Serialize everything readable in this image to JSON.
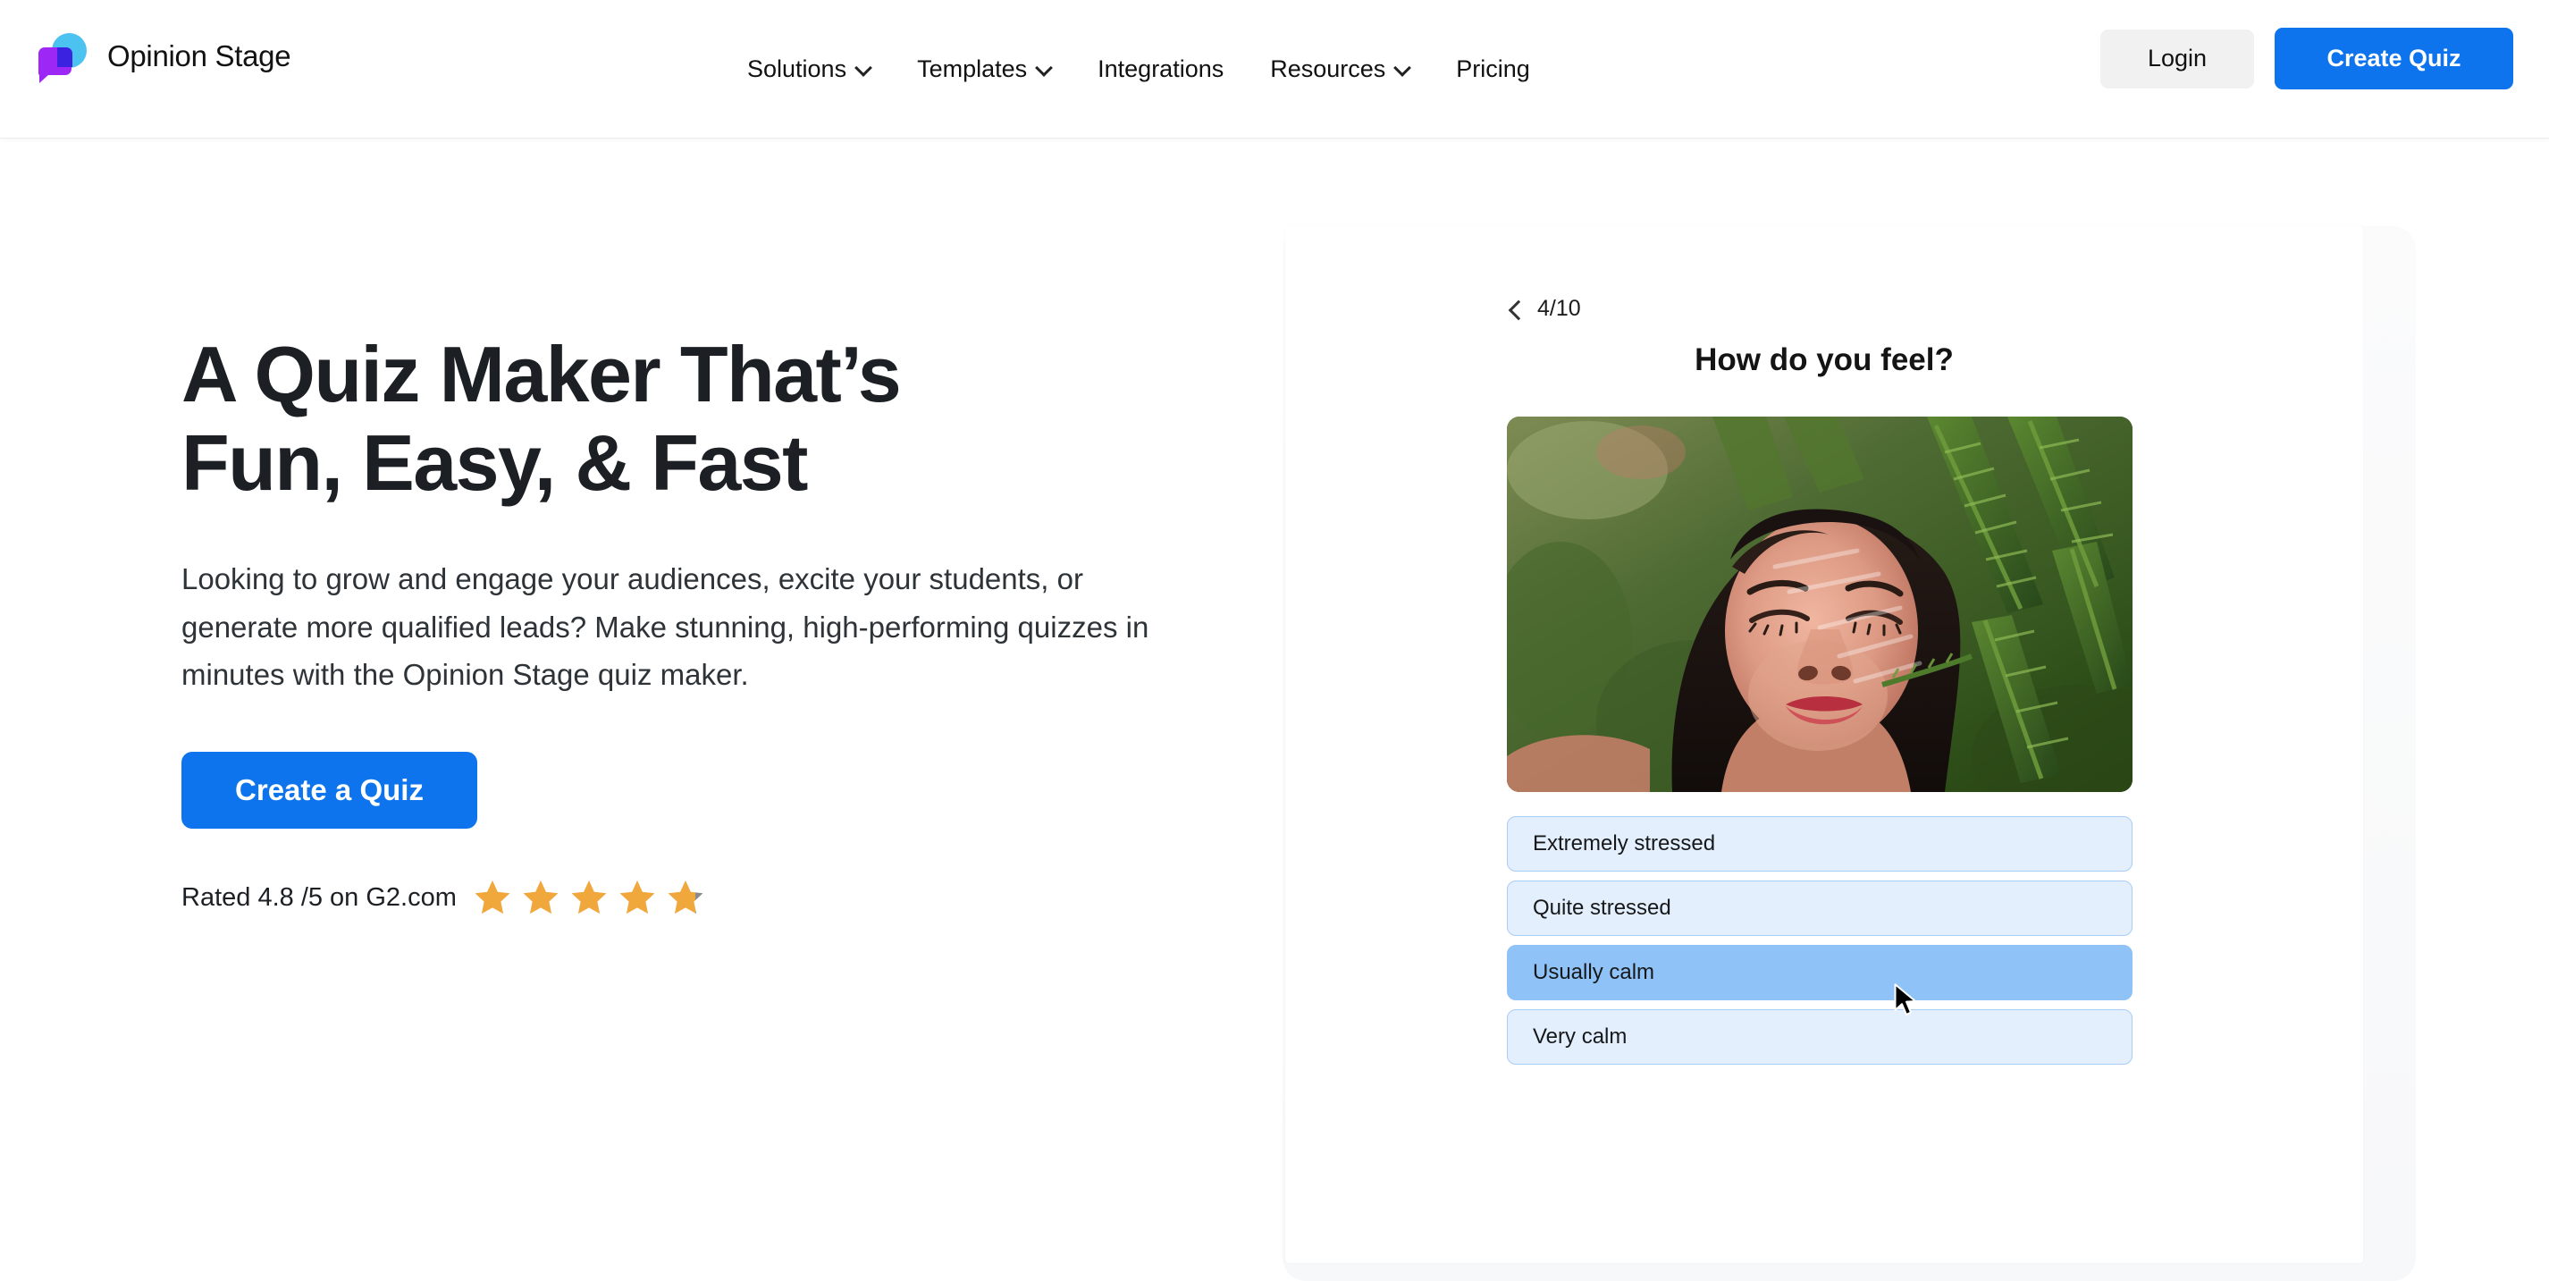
{
  "header": {
    "brand_name": "Opinion Stage",
    "logo_icon": "opinion-stage-logo",
    "nav": [
      {
        "label": "Solutions",
        "has_dropdown": true
      },
      {
        "label": "Templates",
        "has_dropdown": true
      },
      {
        "label": "Integrations",
        "has_dropdown": false
      },
      {
        "label": "Resources",
        "has_dropdown": true
      },
      {
        "label": "Pricing",
        "has_dropdown": false
      }
    ],
    "login_label": "Login",
    "create_quiz_label": "Create Quiz"
  },
  "hero": {
    "title_line1": "A Quiz Maker That’s",
    "title_line2": "Fun, Easy, & Fast",
    "paragraph": "Looking to grow and engage your audiences, excite your students, or generate more qualified leads? Make stunning, high-performing quizzes in minutes with the Opinion Stage quiz maker.",
    "cta_label": "Create a Quiz",
    "rating_text": "Rated 4.8 /5 on G2.com",
    "rating_value": 4.8,
    "rating_max": 5,
    "rating_source": "G2.com",
    "stars_filled": 4,
    "last_star_fill_percent": 78
  },
  "quiz_preview": {
    "back_icon": "chevron-left-icon",
    "progress": "4/10",
    "current_question": 4,
    "total_questions": 10,
    "question": "How do you feel?",
    "image_alt": "woman with closed eyes among green fern leaves",
    "options": [
      {
        "label": "Extremely stressed",
        "hovered": false
      },
      {
        "label": "Quite stressed",
        "hovered": false
      },
      {
        "label": "Usually calm",
        "hovered": true
      },
      {
        "label": "Very calm",
        "hovered": false
      }
    ]
  },
  "colors": {
    "brand_blue": "#0d74ee",
    "logo_purple": "#9d28f5",
    "logo_blue": "#4cc2f1",
    "option_bg": "#e4effd",
    "option_hover_bg": "#8fc3f8",
    "star_gold": "#f0a73c",
    "star_empty": "#8a8a8a",
    "text_dark": "#1c2024"
  }
}
